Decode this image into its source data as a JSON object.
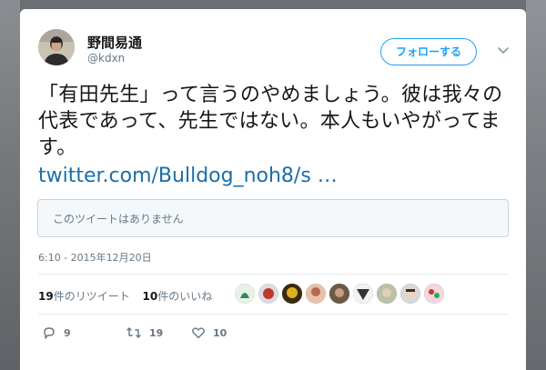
{
  "tweet": {
    "author_name": "野間易通",
    "author_handle": "@kdxn",
    "follow_label": "フォローする",
    "text": "「有田先生」って言うのやめましょう。彼は我々の代表であって、先生ではない。本人もいやがってます。",
    "link_text": "twitter.com/Bulldog_noh8/s …",
    "quoted_unavailable": "このツイートはありません",
    "timestamp": "6:10 - 2015年12月20日"
  },
  "stats": {
    "retweets_count": "19",
    "retweets_label": "件のリツイート",
    "likes_count": "10",
    "likes_label": "件のいいね"
  },
  "likers": [
    {
      "icon": "liker-avatar-1",
      "color": "#2e8b57"
    },
    {
      "icon": "liker-avatar-2",
      "color": "#9aa3ab"
    },
    {
      "icon": "liker-avatar-3",
      "color": "#7a5a20"
    },
    {
      "icon": "liker-avatar-4",
      "color": "#c98a6a"
    },
    {
      "icon": "liker-avatar-5",
      "color": "#5a4a3a"
    },
    {
      "icon": "liker-avatar-6",
      "color": "#3a3a3a"
    },
    {
      "icon": "liker-avatar-7",
      "color": "#8a9a7a"
    },
    {
      "icon": "liker-avatar-8",
      "color": "#7a7a7a"
    },
    {
      "icon": "liker-avatar-9",
      "color": "#c46a7a"
    }
  ],
  "actions": {
    "reply_count": "9",
    "retweet_count": "19",
    "like_count": "10"
  },
  "colors": {
    "accent": "#1da1f2",
    "link": "#1b6ea8",
    "muted": "#657786"
  }
}
